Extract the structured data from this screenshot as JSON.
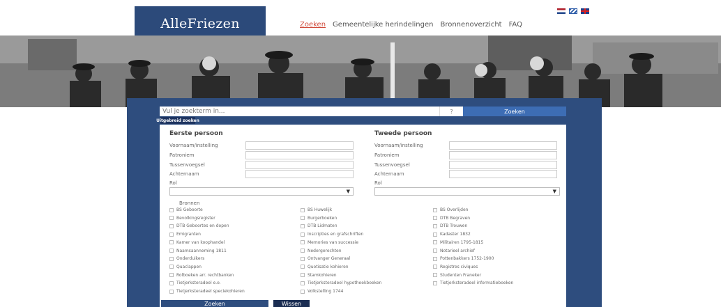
{
  "brand": {
    "logo": "AlleFriezen"
  },
  "nav": {
    "items": [
      "Zoeken",
      "Gemeentelijke herindelingen",
      "Bronnenoverzicht",
      "FAQ"
    ]
  },
  "language_flags": [
    "nl-flag-icon",
    "fy-flag-icon",
    "gb-flag-icon"
  ],
  "search": {
    "placeholder": "Vul je zoekterm in...",
    "help": "?",
    "button": "Zoeken",
    "advanced": "Uitgebreid zoeken"
  },
  "persons": [
    {
      "title": "Eerste persoon",
      "fields": [
        "Voornaam/instelling",
        "Patroniem",
        "Tussenvoegsel",
        "Achternaam"
      ],
      "role_label": "Rol"
    },
    {
      "title": "Tweede persoon",
      "fields": [
        "Voornaam/instelling",
        "Patroniem",
        "Tussenvoegsel",
        "Achternaam"
      ],
      "role_label": "Rol"
    }
  ],
  "sources": {
    "title": "Bronnen",
    "items": [
      "BS Geboorte",
      "BS Huwelijk",
      "BS Overlijden",
      "Bevolkingsregister",
      "Burgerboeken",
      "DTB Begraven",
      "DTB Geboortes en dopen",
      "DTB Lidmaten",
      "DTB Trouwen",
      "Emigranten",
      "Inscripties en grafschriften",
      "Kadaster 1832",
      "Kamer van koophandel",
      "Memories van successie",
      "Militairen 1795-1815",
      "Naamsaanneming 1811",
      "Nedergerechten",
      "Notarieel archief",
      "Onderduikers",
      "Ontvanger Generaal",
      "Pottenbakkers 1752-1900",
      "Quaclappen",
      "Quotisatie kohieren",
      "Registres civiques",
      "Rolboeken arr. rechtbanken",
      "Stamkohieren",
      "Studenten Franeker",
      "Tietjerksteradeel e.o.",
      "Tietjerksteradeel hypotheekboeken",
      "Tietjerksteradeel informatieboeken",
      "Tietjerksteradeel speciekohieren",
      "Volkstelling 1744"
    ]
  },
  "actions": {
    "search": "Zoeken",
    "clear": "Wissen"
  },
  "colors": {
    "brand": "#2c4a7a",
    "button": "#3d6db4",
    "active_link": "#d04a3a"
  }
}
